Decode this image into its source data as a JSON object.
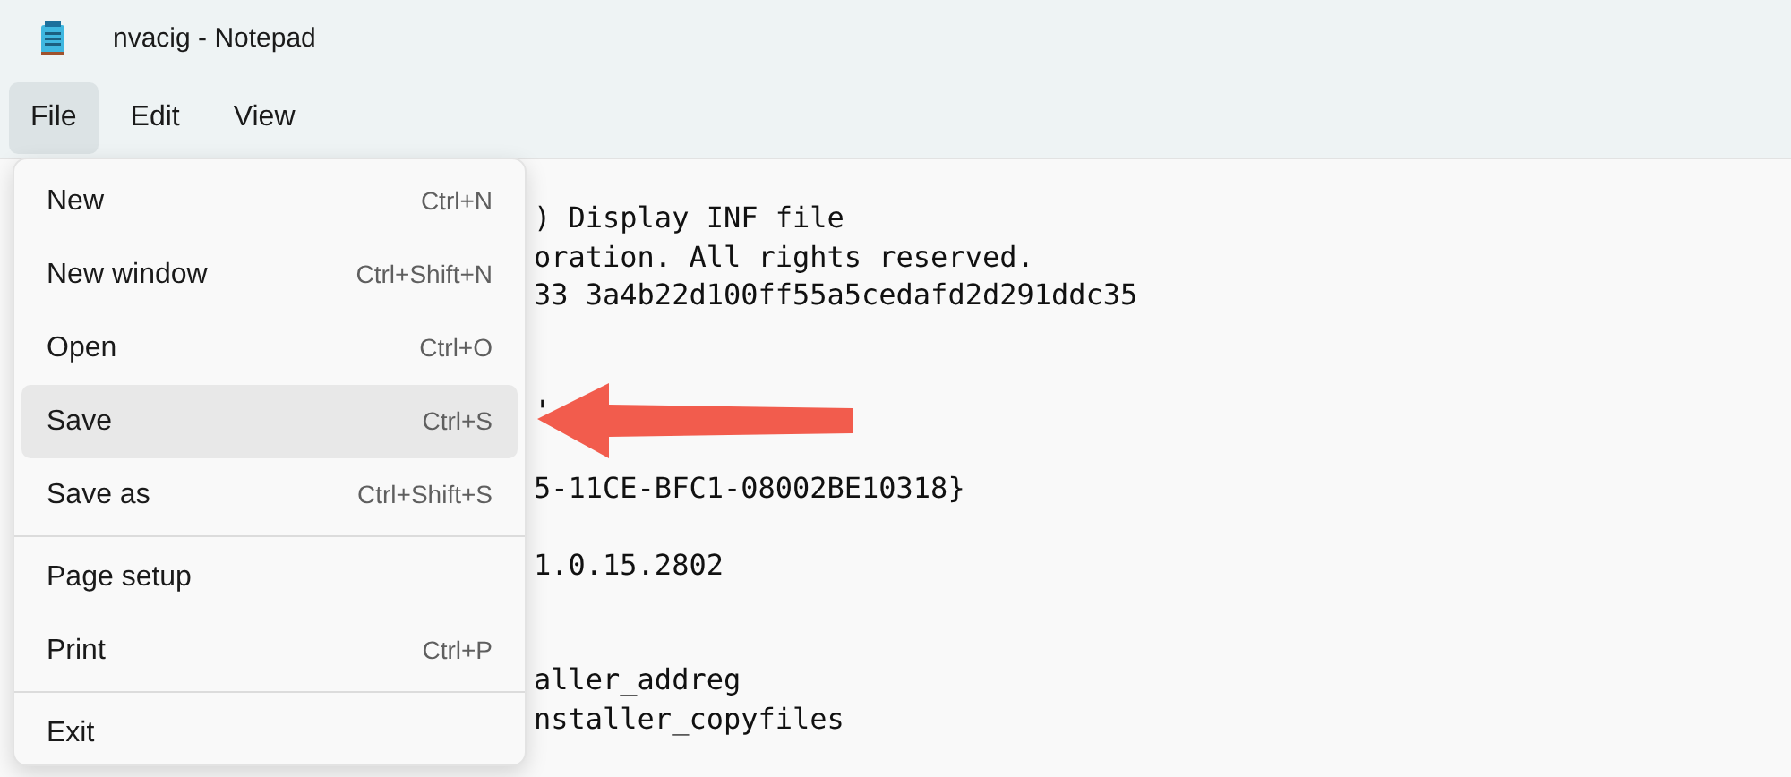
{
  "window": {
    "title": "nvacig - Notepad"
  },
  "menu_bar": [
    {
      "label": "File",
      "selected": true
    },
    {
      "label": "Edit",
      "selected": false
    },
    {
      "label": "View",
      "selected": false
    }
  ],
  "file_menu": [
    [
      {
        "label": "New",
        "shortcut": "Ctrl+N",
        "selected": false
      },
      {
        "label": "New window",
        "shortcut": "Ctrl+Shift+N",
        "selected": false
      },
      {
        "label": "Open",
        "shortcut": "Ctrl+O",
        "selected": false
      },
      {
        "label": "Save",
        "shortcut": "Ctrl+S",
        "selected": true
      },
      {
        "label": "Save as",
        "shortcut": "Ctrl+Shift+S",
        "selected": false
      }
    ],
    [
      {
        "label": "Page setup",
        "selected": false
      },
      {
        "label": "Print",
        "shortcut": "Ctrl+P",
        "selected": false
      }
    ],
    [
      {
        "label": "Exit",
        "selected": false
      }
    ]
  ],
  "editor_lines": [
    ") Display INF file",
    "oration. All rights reserved.",
    "33 3a4b22d100ff55a5cedafd2d291ddc35",
    "'",
    "5-11CE-BFC1-08002BE10318}",
    "1.0.15.2802",
    "aller_addreg",
    "nstaller_copyfiles"
  ]
}
